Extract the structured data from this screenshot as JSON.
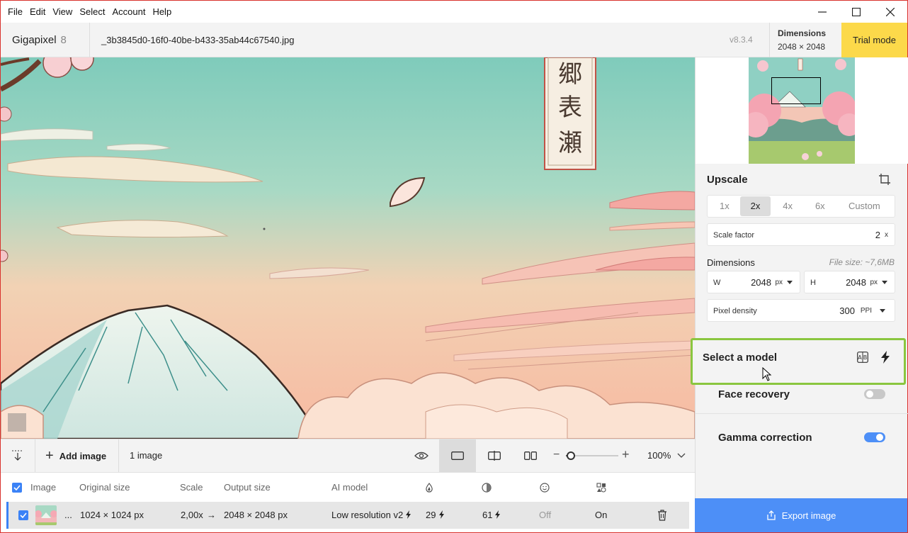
{
  "menu": [
    "File",
    "Edit",
    "View",
    "Select",
    "Account",
    "Help"
  ],
  "window_controls": [
    "minimize-icon",
    "maximize-icon",
    "close-icon"
  ],
  "header": {
    "app_name": "Gigapixel",
    "app_major": "8",
    "file_name": "_3b3845d0-16f0-40be-b433-35ab44c67540.jpg",
    "version": "v8.3.4",
    "dimensions_label": "Dimensions",
    "dimensions_value": "2048 × 2048",
    "trial_label": "Trial mode"
  },
  "toolbar": {
    "add_image": "Add image",
    "image_count": "1 image",
    "zoom": "100%",
    "zoom_level": 0.1,
    "view_modes": [
      "preview-eye-icon",
      "single-view-icon",
      "split-view-icon",
      "side-by-side-icon"
    ],
    "active_view": "single-view-icon"
  },
  "table": {
    "headers": {
      "image": "Image",
      "original_size": "Original size",
      "scale": "Scale",
      "output_size": "Output size",
      "ai_model": "AI model",
      "col_icons": [
        "drop-icon",
        "circle-half-icon",
        "smile-icon",
        "shapes-icon"
      ]
    },
    "row": {
      "name": "...",
      "original_size": "1024 × 1024 px",
      "scale": "2,00x",
      "output_size": "2048 × 2048 px",
      "ai_model": "Low resolution v2",
      "val1": "29",
      "val2": "61",
      "face": "Off",
      "gamma": "On"
    }
  },
  "panel": {
    "upscale_title": "Upscale",
    "scale_options": [
      "1x",
      "2x",
      "4x",
      "6x",
      "Custom"
    ],
    "active_scale": "2x",
    "scale_factor_label": "Scale factor",
    "scale_factor_value": "2",
    "scale_factor_unit": "x",
    "dimensions_label": "Dimensions",
    "file_size": "File size: ~7,6MB",
    "width_label": "W",
    "width_value": "2048",
    "width_unit": "px",
    "height_label": "H",
    "height_value": "2048",
    "height_unit": "px",
    "density_label": "Pixel density",
    "density_value": "300",
    "density_unit": "PPI",
    "select_model_title": "Select a model",
    "face_recovery_label": "Face recovery",
    "face_recovery_on": false,
    "gamma_label": "Gamma correction",
    "gamma_on": true,
    "export_label": "Export image"
  },
  "colors": {
    "accent": "#4d8ff7",
    "trial": "#fcd94a",
    "highlight": "#8ac63f"
  }
}
